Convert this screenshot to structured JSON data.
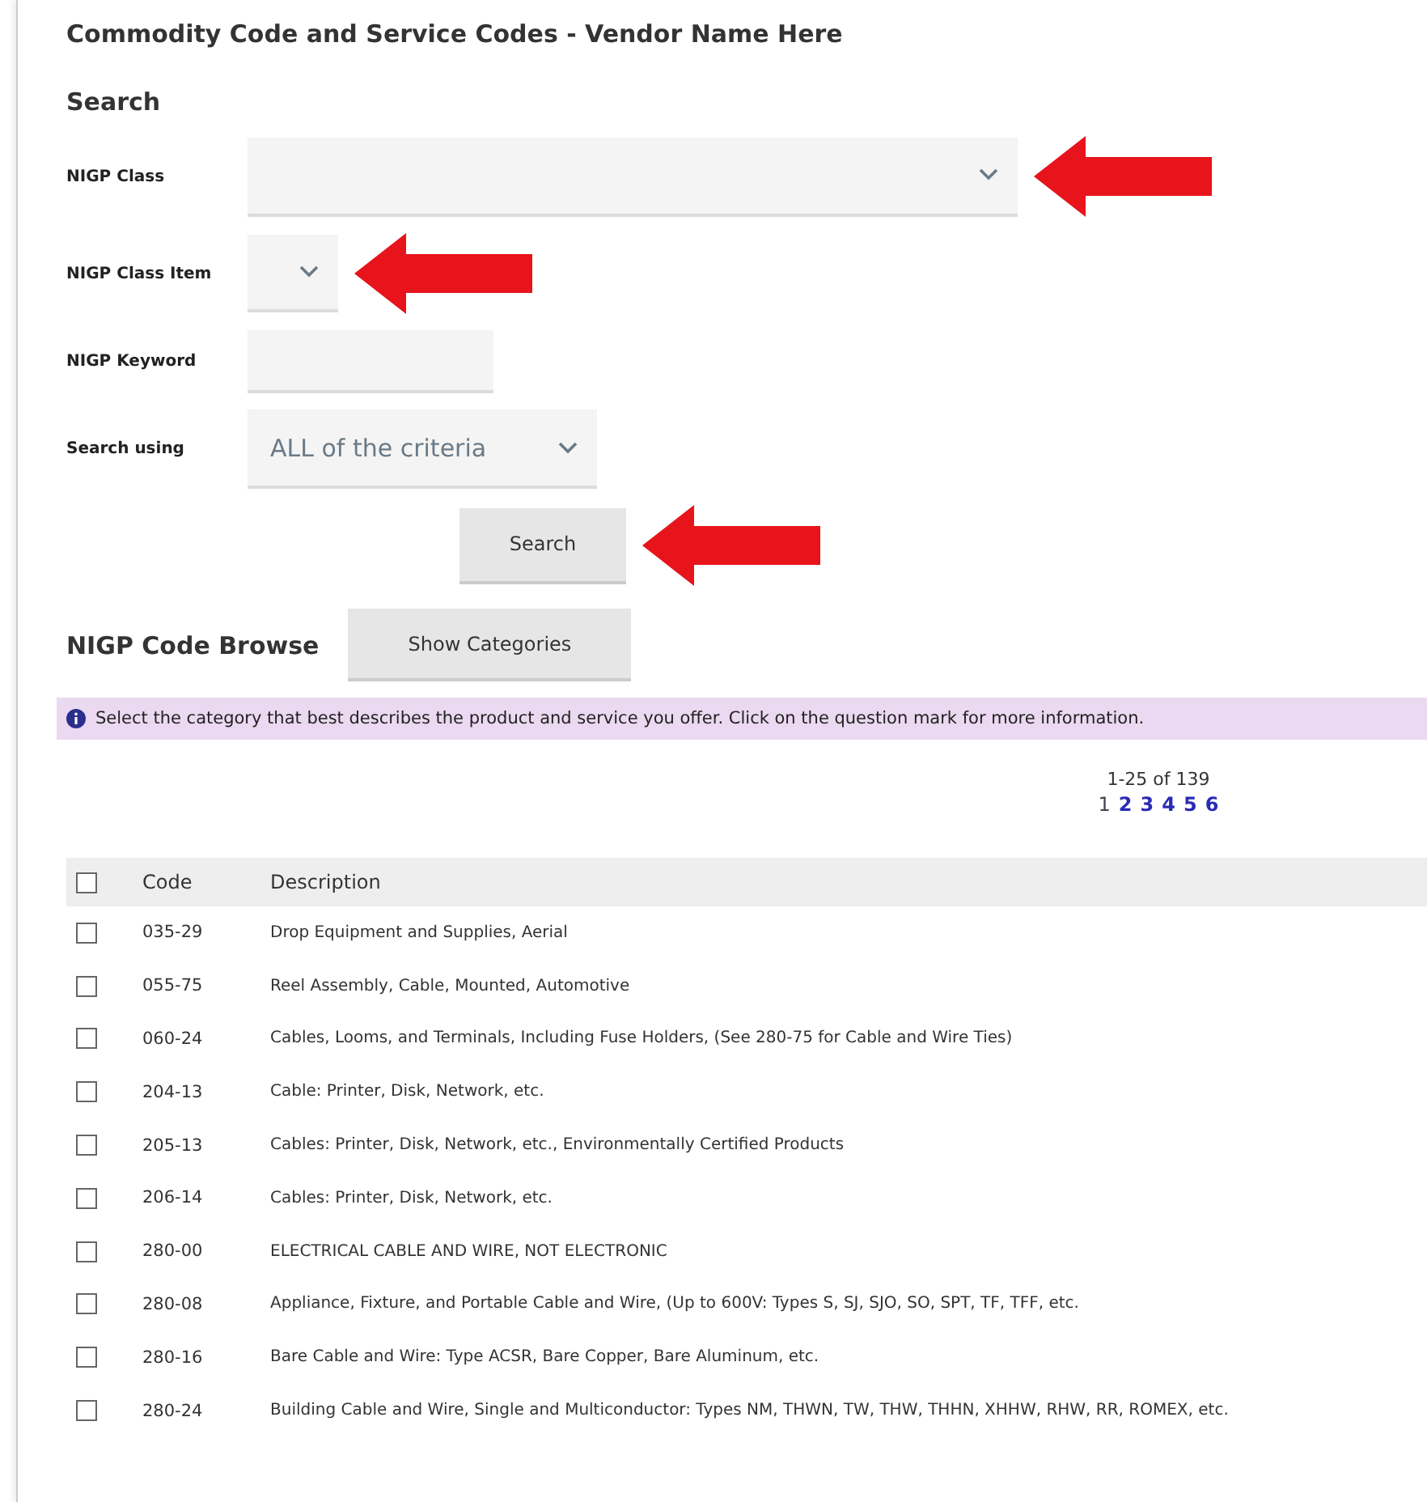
{
  "title": "Commodity Code and Service Codes - Vendor Name Here",
  "search": {
    "heading": "Search",
    "fields": [
      {
        "kind": "select",
        "label": "NIGP Class",
        "annotated": true
      },
      {
        "kind": "select",
        "label": "NIGP Class Item",
        "annotated": true
      },
      {
        "kind": "text",
        "label": "NIGP Keyword",
        "annotated": false
      },
      {
        "kind": "select",
        "label": "Search using",
        "value": "ALL of the criteria",
        "annotated": false
      }
    ],
    "button": {
      "label": "Search",
      "annotated": true
    }
  },
  "browse": {
    "heading": "NIGP Code Browse",
    "button": "Show Categories"
  },
  "info": "Select the category that best describes the product and service you offer. Click on the question mark for more information.",
  "pager": {
    "range": "1-25 of 139",
    "pages": [
      {
        "label": "1",
        "selected": true
      },
      {
        "label": "2",
        "selected": false
      },
      {
        "label": "3",
        "selected": false
      },
      {
        "label": "4",
        "selected": false
      },
      {
        "label": "5",
        "selected": false
      },
      {
        "label": "6",
        "selected": false
      }
    ]
  },
  "table": {
    "all_checked": false,
    "columns": [
      "Code",
      "Description"
    ],
    "rows": [
      {
        "code": "035-29",
        "description": "Drop Equipment and Supplies, Aerial",
        "checked": false
      },
      {
        "code": "055-75",
        "description": "Reel Assembly, Cable, Mounted, Automotive",
        "checked": false
      },
      {
        "code": "060-24",
        "description": "Cables, Looms, and Terminals, Including Fuse Holders, (See 280-75 for Cable and Wire Ties)",
        "checked": false
      },
      {
        "code": "204-13",
        "description": "Cable: Printer, Disk, Network, etc.",
        "checked": false
      },
      {
        "code": "205-13",
        "description": "Cables: Printer, Disk, Network, etc., Environmentally Certified Products",
        "checked": false
      },
      {
        "code": "206-14",
        "description": "Cables: Printer, Disk, Network, etc.",
        "checked": false
      },
      {
        "code": "280-00",
        "description": "ELECTRICAL CABLE AND WIRE, NOT ELECTRONIC",
        "checked": false
      },
      {
        "code": "280-08",
        "description": "Appliance, Fixture, and Portable Cable and Wire, (Up to 600V: Types S, SJ, SJO, SO, SPT, TF, TFF, etc.",
        "checked": false
      },
      {
        "code": "280-16",
        "description": "Bare Cable and Wire: Type ACSR, Bare Copper, Bare Aluminum, etc.",
        "checked": false
      },
      {
        "code": "280-24",
        "description": "Building Cable and Wire, Single and Multiconductor: Types NM, THWN, TW, THW, THHN, XHHW, RHW, RR, ROMEX, etc.",
        "checked": false
      }
    ]
  }
}
